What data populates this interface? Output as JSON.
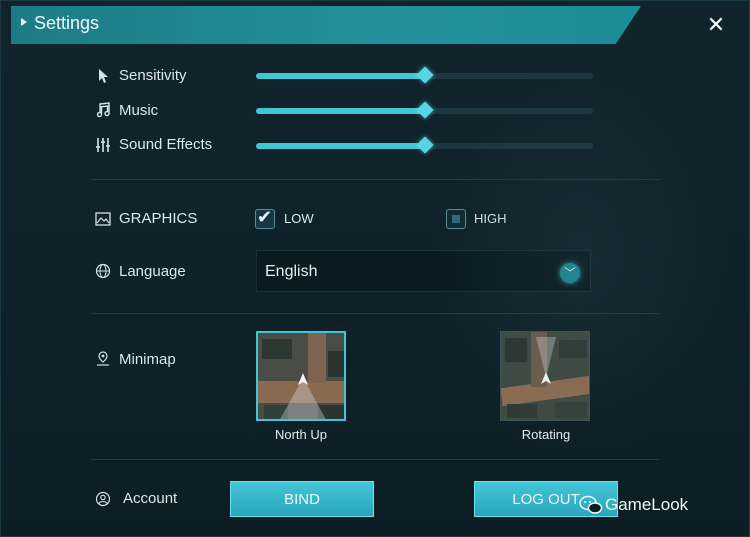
{
  "window": {
    "title": "Settings",
    "close_glyph": "✕"
  },
  "audio": {
    "sensitivity": {
      "label": "Sensitivity",
      "icon": "cursor-icon",
      "level": 0.5
    },
    "music": {
      "label": "Music",
      "icon": "music-note-icon",
      "level": 0.5
    },
    "sound_effects": {
      "label": "Sound Effects",
      "icon": "equalizer-icon",
      "level": 0.5
    }
  },
  "graphics": {
    "label": "GRAPHICS",
    "icon": "image-icon",
    "options": [
      {
        "label": "LOW",
        "checked": true
      },
      {
        "label": "HIGH",
        "checked": false
      }
    ]
  },
  "language": {
    "label": "Language",
    "icon": "globe-icon",
    "value": "English"
  },
  "minimap": {
    "label": "Minimap",
    "icon": "map-pin-icon",
    "options": [
      {
        "label": "North Up",
        "selected": true
      },
      {
        "label": "Rotating",
        "selected": false
      }
    ]
  },
  "account": {
    "label": "Account",
    "icon": "user-circle-icon",
    "bind_label": "BIND",
    "logout_label": "LOG OUT"
  },
  "watermark": {
    "text": "GameLook"
  },
  "colors": {
    "accent": "#3fc7d6",
    "title_bar": "#1d7b86"
  }
}
